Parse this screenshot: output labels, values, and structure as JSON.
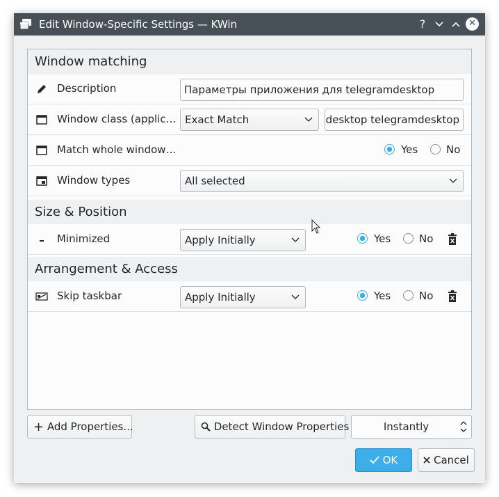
{
  "window": {
    "title": "Edit Window-Specific Settings — KWin",
    "help_glyph": "?",
    "minimize_glyph": "⌄",
    "maximize_glyph": "⌃",
    "close_glyph": "✕",
    "accent_color": "#3daee9",
    "titlebar_color": "#475057"
  },
  "sections": {
    "window_matching": "Window matching",
    "size_position": "Size & Position",
    "arrangement_access": "Arrangement & Access"
  },
  "rows": {
    "description": {
      "label": "Description",
      "value": "Параметры приложения для telegramdesktop",
      "icon": "pencil-icon"
    },
    "window_class": {
      "label": "Window class (applicat...",
      "match_type": "Exact Match",
      "value": "-desktop telegramdesktop",
      "icon": "window-icon"
    },
    "match_whole": {
      "label": "Match whole window ...",
      "yes": "Yes",
      "no": "No",
      "selected": "Yes",
      "icon": "window-icon"
    },
    "window_types": {
      "label": "Window types",
      "value": "All selected",
      "icon": "window-types-icon"
    },
    "minimized": {
      "label": "Minimized",
      "policy": "Apply Initially",
      "yes": "Yes",
      "no": "No",
      "selected": "Yes",
      "icon": "minimize-icon"
    },
    "skip_taskbar": {
      "label": "Skip taskbar",
      "policy": "Apply Initially",
      "yes": "Yes",
      "no": "No",
      "selected": "Yes",
      "icon": "skip-taskbar-icon"
    }
  },
  "footer": {
    "add_properties": "Add Properties...",
    "detect_properties": "Detect Window Properties",
    "detect_delay": "Instantly",
    "ok": "OK",
    "cancel": "Cancel"
  }
}
